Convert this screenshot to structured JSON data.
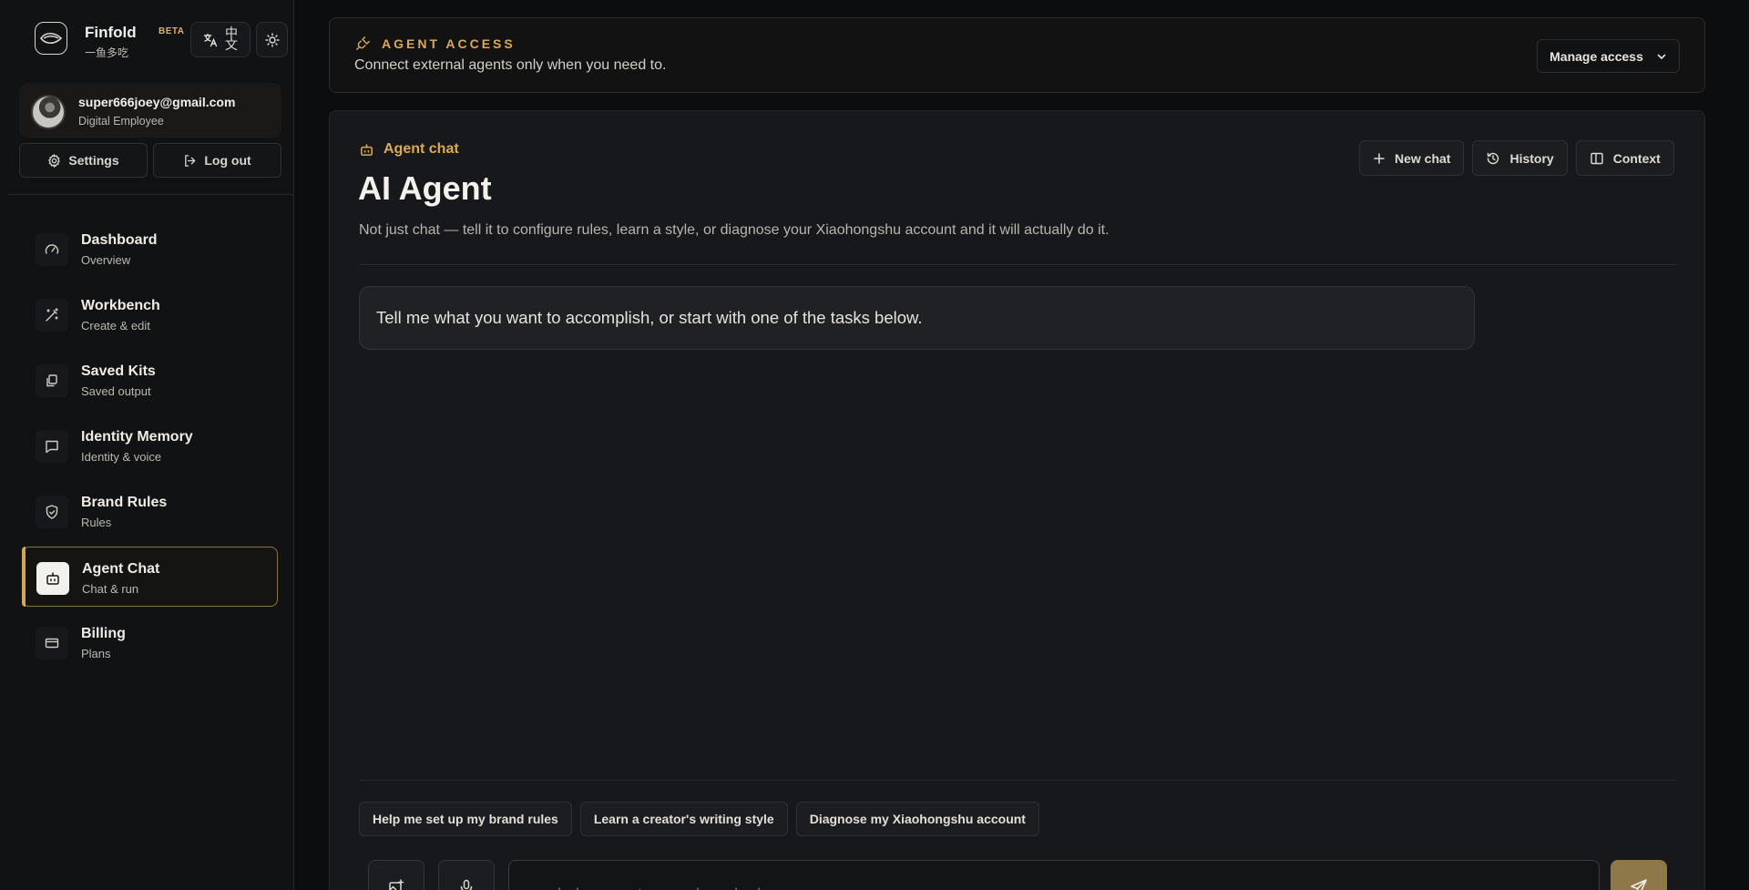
{
  "brand": {
    "name": "Finfold",
    "badge": "BETA",
    "subtitle": "一鱼多吃",
    "lang_toggle": "中文",
    "lang_zh_top": "中",
    "lang_zh_bottom": "文"
  },
  "user": {
    "email": "super666joey@gmail.com",
    "role": "Digital Employee"
  },
  "account_actions": {
    "settings_label": "Settings",
    "logout_label": "Log out"
  },
  "nav": {
    "items": [
      {
        "title": "Dashboard",
        "subtitle": "Overview",
        "icon": "gauge-icon"
      },
      {
        "title": "Workbench",
        "subtitle": "Create & edit",
        "icon": "magic-wand-icon"
      },
      {
        "title": "Saved Kits",
        "subtitle": "Saved output",
        "icon": "copy-icon"
      },
      {
        "title": "Identity Memory",
        "subtitle": "Identity & voice",
        "icon": "message-square-icon"
      },
      {
        "title": "Brand Rules",
        "subtitle": "Rules",
        "icon": "shield-check-icon"
      },
      {
        "title": "Agent Chat",
        "subtitle": "Chat & run",
        "icon": "bot-icon",
        "active": true
      },
      {
        "title": "Billing",
        "subtitle": "Plans",
        "icon": "credit-card-icon"
      }
    ]
  },
  "agent_access": {
    "title": "AGENT ACCESS",
    "subtitle": "Connect external agents only when you need to.",
    "manage_label": "Manage access"
  },
  "panel": {
    "kicker": "Agent chat",
    "title": "AI Agent",
    "description": "Not just chat — tell it to configure rules, learn a style, or diagnose your Xiaohongshu account and it will actually do it.",
    "actions": {
      "new_chat": "New chat",
      "history": "History",
      "context": "Context"
    },
    "welcome_message": "Tell me what you want to accomplish, or start with one of the tasks below.",
    "suggestions": [
      "Help me set up my brand rules",
      "Learn a creator's writing style",
      "Diagnose my Xiaohongshu account"
    ],
    "input_placeholder": "e.g. help me set up my brand rules..."
  },
  "colors": {
    "accent": "#d9aa54",
    "background": "#0c0d0f",
    "panel": "#17181b",
    "send_button": "#8e7749"
  }
}
